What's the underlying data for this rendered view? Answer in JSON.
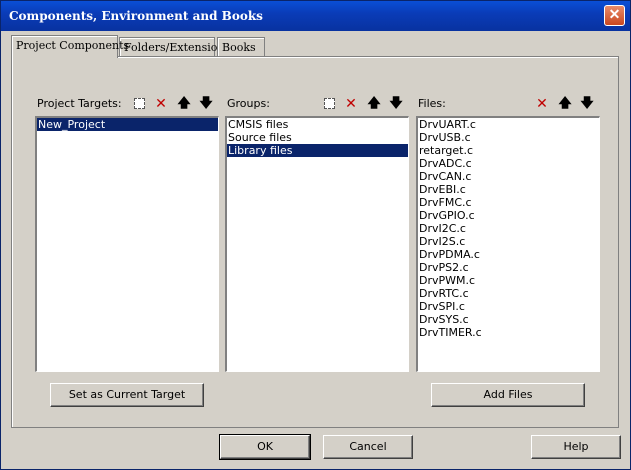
{
  "window": {
    "title": "Components, Environment and Books",
    "close_glyph": "✕"
  },
  "tabs": [
    {
      "label": "Project Components"
    },
    {
      "label": "Folders/Extensions"
    },
    {
      "label": "Books"
    }
  ],
  "targets": {
    "label": "Project Targets:",
    "items": [
      "New_Project"
    ],
    "selected": "New_Project"
  },
  "groups": {
    "label": "Groups:",
    "items": [
      "CMSIS files",
      "Source files",
      "Library files"
    ],
    "selected": "Library files"
  },
  "files": {
    "label": "Files:",
    "items": [
      "DrvUART.c",
      "DrvUSB.c",
      "retarget.c",
      "DrvADC.c",
      "DrvCAN.c",
      "DrvEBI.c",
      "DrvFMC.c",
      "DrvGPIO.c",
      "DrvI2C.c",
      "DrvI2S.c",
      "DrvPDMA.c",
      "DrvPS2.c",
      "DrvPWM.c",
      "DrvRTC.c",
      "DrvSPI.c",
      "DrvSYS.c",
      "DrvTIMER.c"
    ]
  },
  "buttons": {
    "set_current_target": "Set as Current Target",
    "add_files": "Add Files",
    "ok": "OK",
    "cancel": "Cancel",
    "help": "Help"
  },
  "icons": {
    "new": "new-item-icon",
    "delete": "delete-icon",
    "up": "move-up-icon",
    "down": "move-down-icon",
    "up_glyph": "🡅",
    "down_glyph": "🡇",
    "delete_glyph": "✕"
  },
  "colors": {
    "titlebar": "#0a3cb8",
    "selection": "#0a246a",
    "face": "#d4d0c8"
  }
}
